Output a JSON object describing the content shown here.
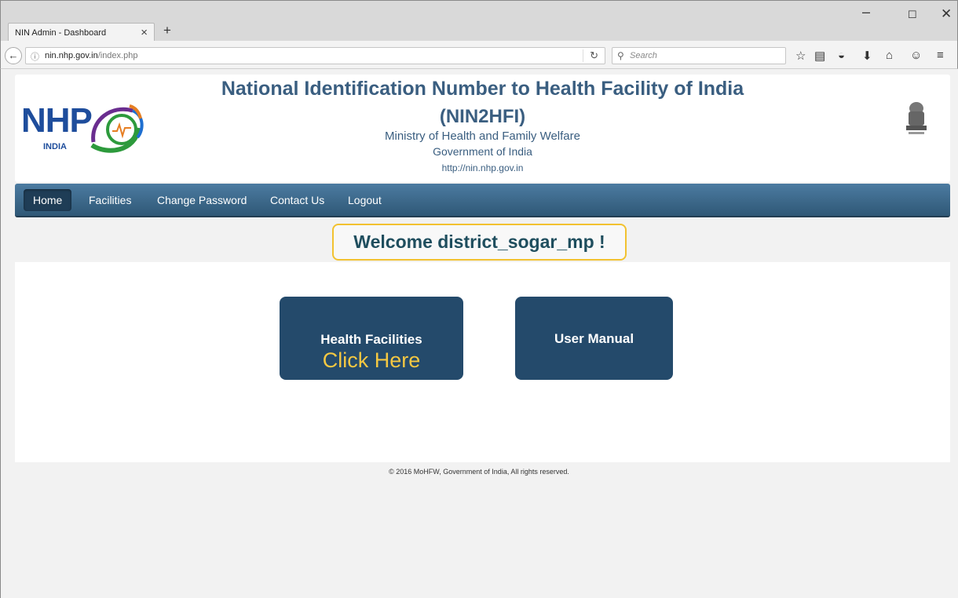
{
  "browser": {
    "tab_title": "NIN Admin - Dashboard",
    "tab_close": "×",
    "new_tab": "+",
    "url_host": "nin.nhp.gov.in",
    "url_path": "/index.php",
    "url_prefix": "",
    "search_placeholder": "Search",
    "window_min": "–",
    "window_max": "☐",
    "window_close": "✕"
  },
  "header": {
    "logo_text": "NHP",
    "logo_sub": "INDIA",
    "title_line1": "National Identification Number to Health Facility of India",
    "title_line2": "(NIN2HFI)",
    "ministry": "Ministry of Health and Family Welfare",
    "government": "Government of India",
    "site_url": "http://nin.nhp.gov.in"
  },
  "nav": {
    "items": [
      {
        "label": "Home",
        "active": true
      },
      {
        "label": "Facilities",
        "active": false
      },
      {
        "label": "Change Password",
        "active": false
      },
      {
        "label": "Contact Us",
        "active": false
      },
      {
        "label": "Logout",
        "active": false
      }
    ]
  },
  "welcome": "Welcome district_sogar_mp !",
  "tiles": {
    "health_label": "Health Facilities",
    "health_link": "Click Here",
    "manual_label": "User Manual"
  },
  "footer": "© 2016 MoHFW, Government of India, All rights reserved.",
  "colors": {
    "nav_bg": "#3d6a8f",
    "tile_bg": "#244a6b",
    "accent": "#f5c842",
    "title": "#3a5e80"
  }
}
